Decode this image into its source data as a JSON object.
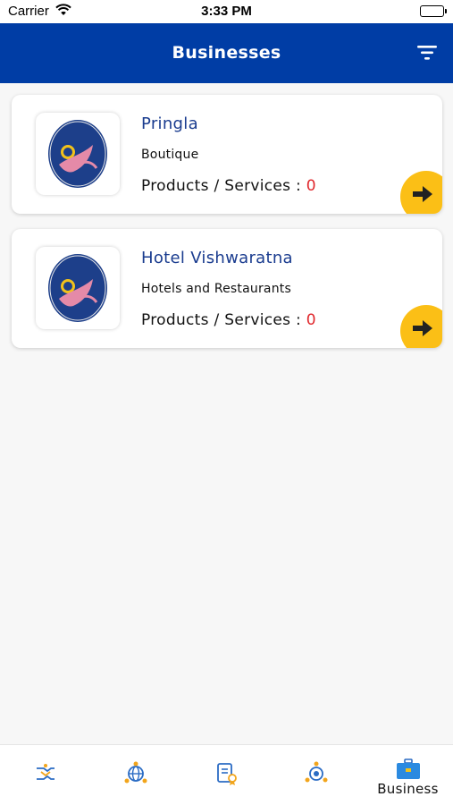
{
  "status_bar": {
    "carrier": "Carrier",
    "time": "3:33 PM"
  },
  "header": {
    "title": "Businesses",
    "filter_icon": "filter-icon"
  },
  "businesses": [
    {
      "name": "Pringla",
      "category": "Boutique",
      "products_label": "Products / Services :",
      "products_count": "0"
    },
    {
      "name": "Hotel Vishwaratna",
      "category": "Hotels and Restaurants",
      "products_label": "Products / Services :",
      "products_count": "0"
    }
  ],
  "tab_bar": {
    "tabs": [
      {
        "icon": "handshake-icon",
        "label": ""
      },
      {
        "icon": "globe-network-icon",
        "label": ""
      },
      {
        "icon": "certificate-icon",
        "label": ""
      },
      {
        "icon": "community-icon",
        "label": ""
      },
      {
        "icon": "briefcase-icon",
        "label": "Business"
      }
    ],
    "active_index": 4
  },
  "colors": {
    "primary": "#003da5",
    "accent": "#fbbf16",
    "count": "#e0262b",
    "name": "#1a3c8f"
  }
}
